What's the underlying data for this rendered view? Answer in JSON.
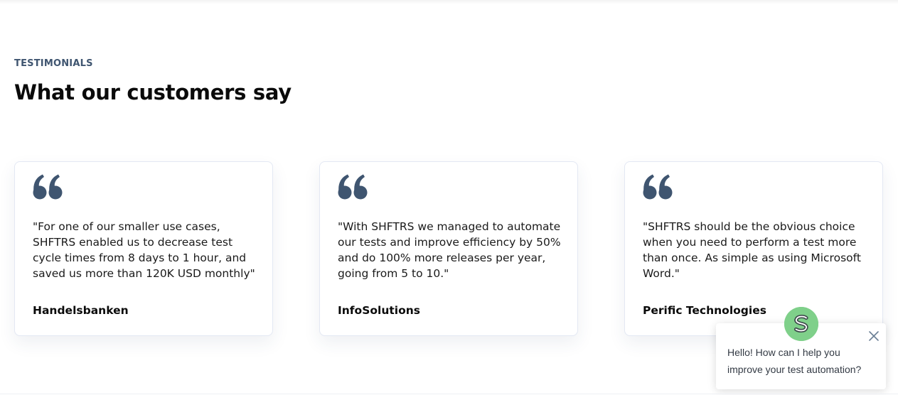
{
  "section": {
    "eyebrow": "TESTIMONIALS",
    "heading": "What our customers say"
  },
  "testimonials": [
    {
      "quote": "\"For one of our smaller use cases, SHFTRS enabled us to decrease test cycle times from 8 days to 1 hour, and saved us more than 120K USD monthly\"",
      "company": "Handelsbanken",
      "icon": "quote-icon"
    },
    {
      "quote": "\"With SHFTRS we managed to automate our tests and improve efficiency by 50% and do 100% more releases per year, going from 5 to 10.\"",
      "company": "InfoSolutions",
      "icon": "quote-icon"
    },
    {
      "quote": "\"SHFTRS should be the obvious choice when you need to perform a test more than once. As simple as using Microsoft Word.\"",
      "company": "Perific Technologies",
      "icon": "quote-icon"
    }
  ],
  "chat": {
    "message": "Hello! How can I help you improve your test automation?",
    "close_icon": "close-icon",
    "avatar_icon": "chat-avatar-icon",
    "avatar_color": "#7fd08a"
  },
  "colors": {
    "accent": "#3f5570",
    "heading": "#0a0a0a",
    "card_border": "#e3e8f3"
  }
}
